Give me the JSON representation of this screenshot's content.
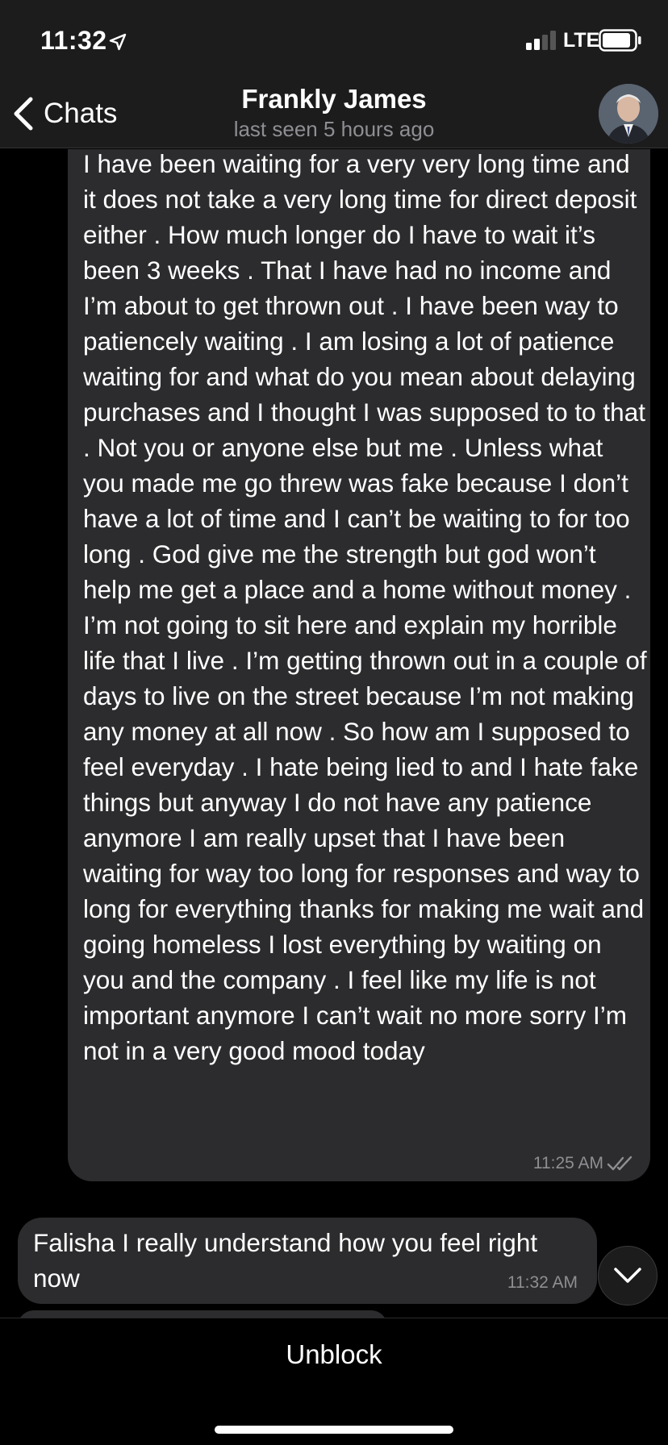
{
  "status_bar": {
    "time": "11:32",
    "network": "LTE",
    "icons": [
      "location-arrow-icon",
      "signal-icon",
      "battery-icon"
    ]
  },
  "header": {
    "back_label": "Chats",
    "back_icon": "chevron-left-icon",
    "title": "Frankly James",
    "subtitle": "last seen 5 hours ago"
  },
  "messages": [
    {
      "direction": "outgoing",
      "text": "I have been waiting for a very very long time and it does not take a very long time for direct deposit either . How much longer do I have to wait it’s been 3 weeks . That I have had no income and I’m about to get thrown out . I have been way to patiencely waiting . I am losing a lot of patience waiting for  and what do you mean about delaying purchases and I thought I was supposed to to that . Not you or anyone else but me . Unless what you made me go threw was fake because I don’t have a lot of time and I can’t be waiting to for too long . God give me the strength but god won’t help me get a place and a home without money . I’m not going to sit here and explain my horrible life that I live . I’m getting thrown out in a couple of days to live on the street because I’m not making any money at all now . So how am I supposed to feel everyday . I hate being lied to and I hate fake things but anyway I do not have any patience anymore I am really upset that I have been waiting for way too long for responses and way to long for everything thanks for making me wait and going homeless I lost everything by waiting on you and the company . I feel like my life is not important anymore I can’t wait no more sorry I’m not in a very good mood today",
      "time": "11:25 AM",
      "status_icon": "double-check-icon"
    },
    {
      "direction": "incoming",
      "text": "Falisha I really understand how you feel right now",
      "time": "11:32 AM"
    }
  ],
  "scroll_down_icon": "chevron-down-icon",
  "footer": {
    "unblock_label": "Unblock"
  },
  "colors": {
    "background": "#000000",
    "bar_background": "#1c1c1d",
    "bubble": "#2c2c2e",
    "secondary_text": "#8e8e93"
  }
}
